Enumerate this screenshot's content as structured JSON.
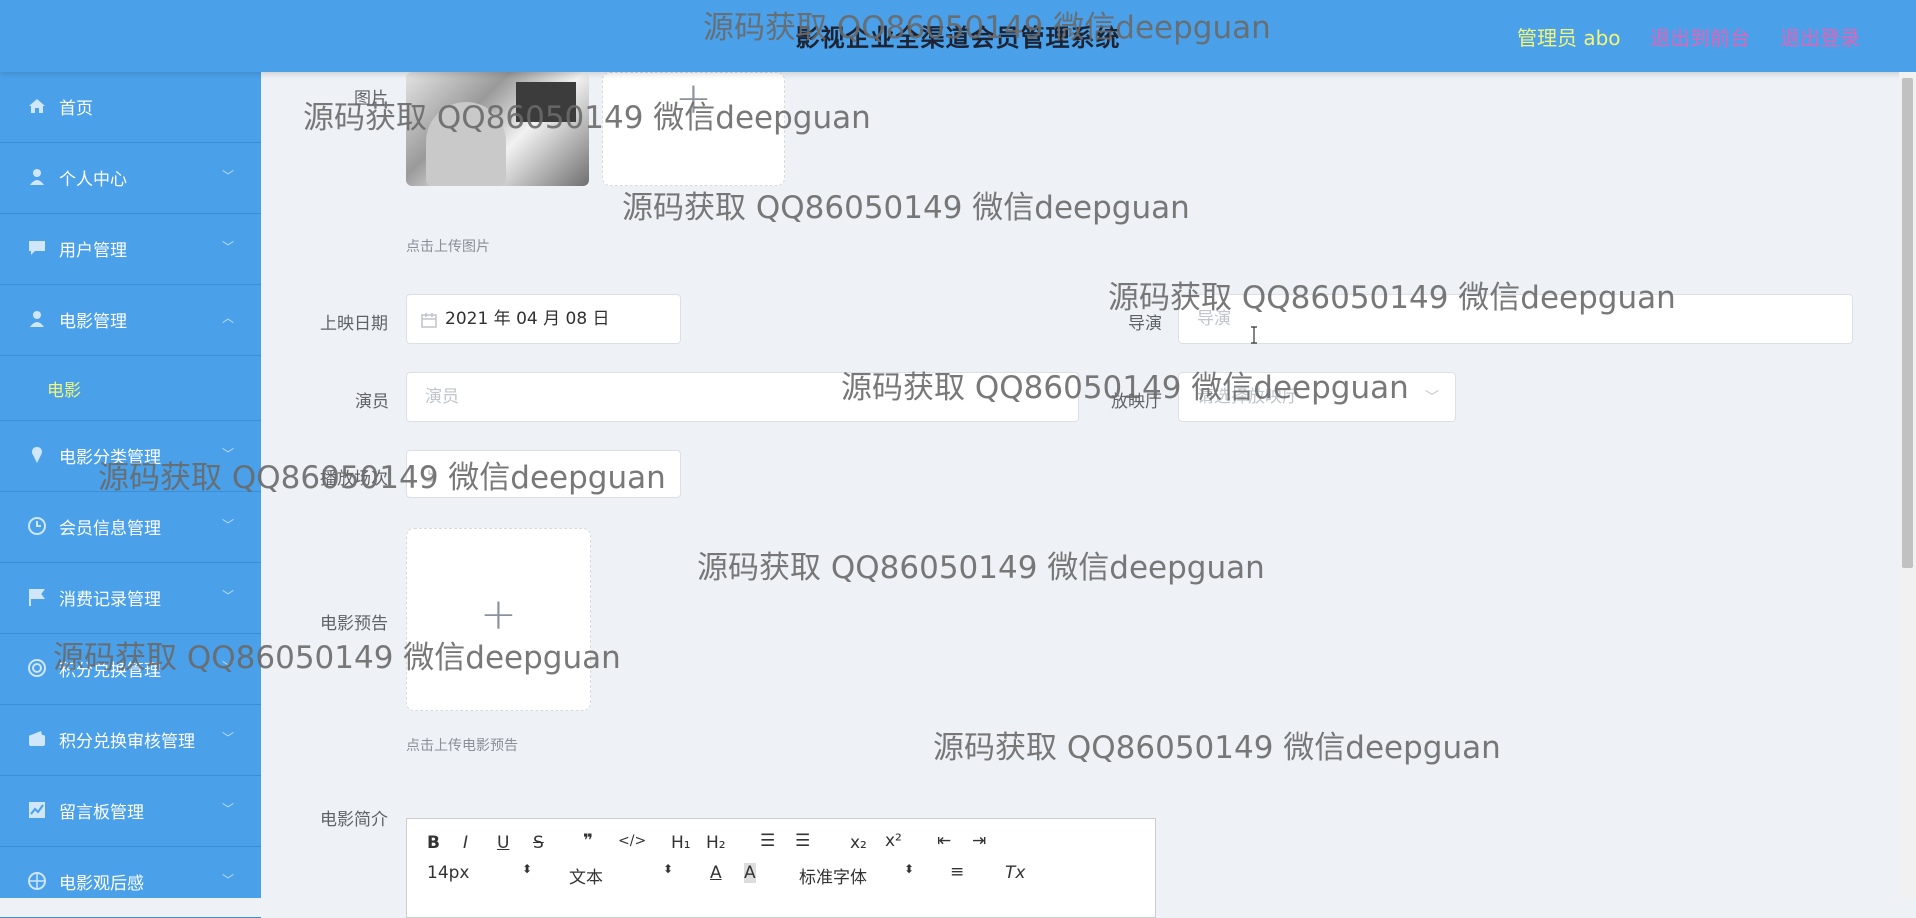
{
  "header": {
    "title": "影视企业全渠道会员管理系统",
    "admin": "管理员 abo",
    "back_front": "退出到前台",
    "logout": "退出登录"
  },
  "sidebar": {
    "items": [
      {
        "label": "首页",
        "icon": "home-icon"
      },
      {
        "label": "个人中心",
        "icon": "user-icon"
      },
      {
        "label": "用户管理",
        "icon": "chat-icon"
      },
      {
        "label": "电影管理",
        "icon": "user-icon"
      },
      {
        "label": "电影",
        "icon": ""
      },
      {
        "label": "电影分类管理",
        "icon": "pin-icon"
      },
      {
        "label": "会员信息管理",
        "icon": "clock-icon"
      },
      {
        "label": "消费记录管理",
        "icon": "flag-icon"
      },
      {
        "label": "积分兑换管理",
        "icon": "target-icon"
      },
      {
        "label": "积分兑换审核管理",
        "icon": "wallet-icon"
      },
      {
        "label": "留言板管理",
        "icon": "chart-icon"
      },
      {
        "label": "电影观后感",
        "icon": "compass-icon"
      }
    ]
  },
  "form": {
    "image_label": "图片",
    "image_hint": "点击上传图片",
    "release_label": "上映日期",
    "release_value": "2021 年 04 月 08 日",
    "director_label": "导演",
    "director_placeholder": "导演",
    "actor_label": "演员",
    "actor_placeholder": "演员",
    "hall_label": "放映厅",
    "hall_placeholder": "请选择放映厅",
    "showtime_label": "播放场次",
    "trailer_label": "电影预告",
    "trailer_hint": "点击上传电影预告",
    "intro_label": "电影简介"
  },
  "editor": {
    "font_size": "14px",
    "text_type": "文本",
    "font_family": "标准字体"
  },
  "watermark": "源码获取 QQ86050149 微信deepguan"
}
